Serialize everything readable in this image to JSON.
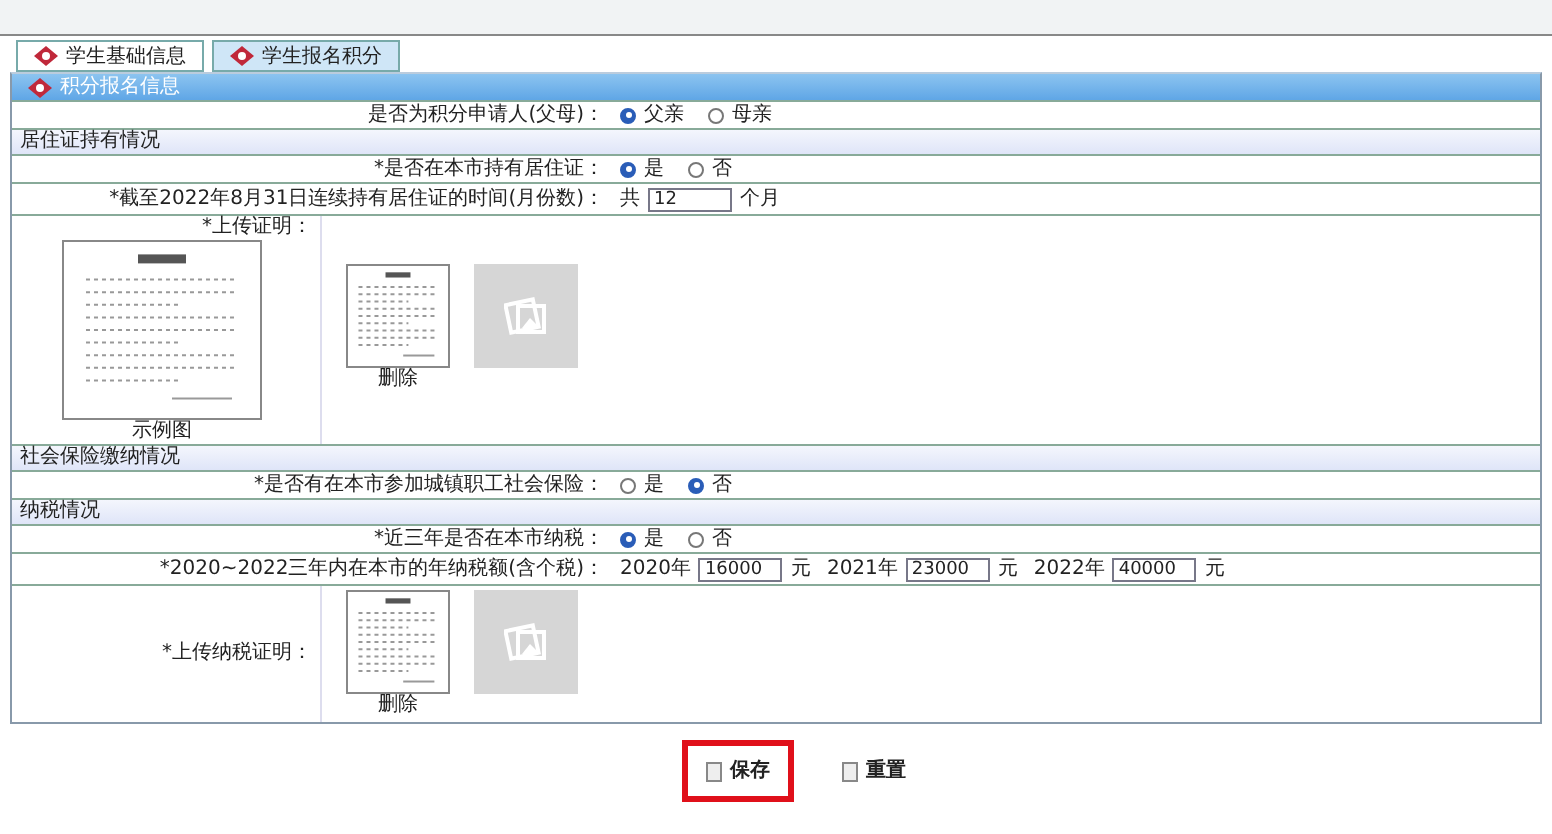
{
  "tabs": [
    {
      "label": "学生基础信息",
      "selected": false
    },
    {
      "label": "学生报名积分",
      "selected": true
    }
  ],
  "panel_title": "积分报名信息",
  "rows": [
    {
      "kind": "radio",
      "label": "是否为积分申请人(父母)：",
      "options": [
        {
          "label": "父亲",
          "selected": true
        },
        {
          "label": "母亲",
          "selected": false
        }
      ]
    },
    {
      "kind": "section",
      "label": "居住证持有情况"
    },
    {
      "kind": "radio",
      "label": "*是否在本市持有居住证：",
      "options": [
        {
          "label": "是",
          "selected": true
        },
        {
          "label": "否",
          "selected": false
        }
      ]
    },
    {
      "kind": "fields",
      "label": "*截至2022年8月31日连续持有居住证的时间(月份数)：",
      "fields": [
        {
          "prefix": "共",
          "value": "12",
          "suffix": "个月"
        }
      ]
    },
    {
      "kind": "upload",
      "label": "*上传证明：",
      "sample_caption": "示例图",
      "files": [
        {
          "caption": "删除"
        }
      ]
    },
    {
      "kind": "section",
      "label": "社会保险缴纳情况"
    },
    {
      "kind": "radio",
      "label": "*是否有在本市参加城镇职工社会保险：",
      "options": [
        {
          "label": "是",
          "selected": false
        },
        {
          "label": "否",
          "selected": true
        }
      ]
    },
    {
      "kind": "section",
      "label": "纳税情况"
    },
    {
      "kind": "radio",
      "label": "*近三年是否在本市纳税：",
      "options": [
        {
          "label": "是",
          "selected": true
        },
        {
          "label": "否",
          "selected": false
        }
      ]
    },
    {
      "kind": "fields",
      "label": "*2020~2022三年内在本市的年纳税额(含个税)：",
      "fields": [
        {
          "prefix": "2020年",
          "value": "16000",
          "suffix": "元"
        },
        {
          "prefix": "2021年",
          "value": "23000",
          "suffix": "元"
        },
        {
          "prefix": "2022年",
          "value": "40000",
          "suffix": "元"
        }
      ]
    },
    {
      "kind": "upload",
      "label": "*上传纳税证明：",
      "files": [
        {
          "caption": "删除"
        }
      ]
    }
  ],
  "buttons": [
    {
      "label": "保存",
      "highlighted": true
    },
    {
      "label": "重置",
      "highlighted": false
    }
  ]
}
